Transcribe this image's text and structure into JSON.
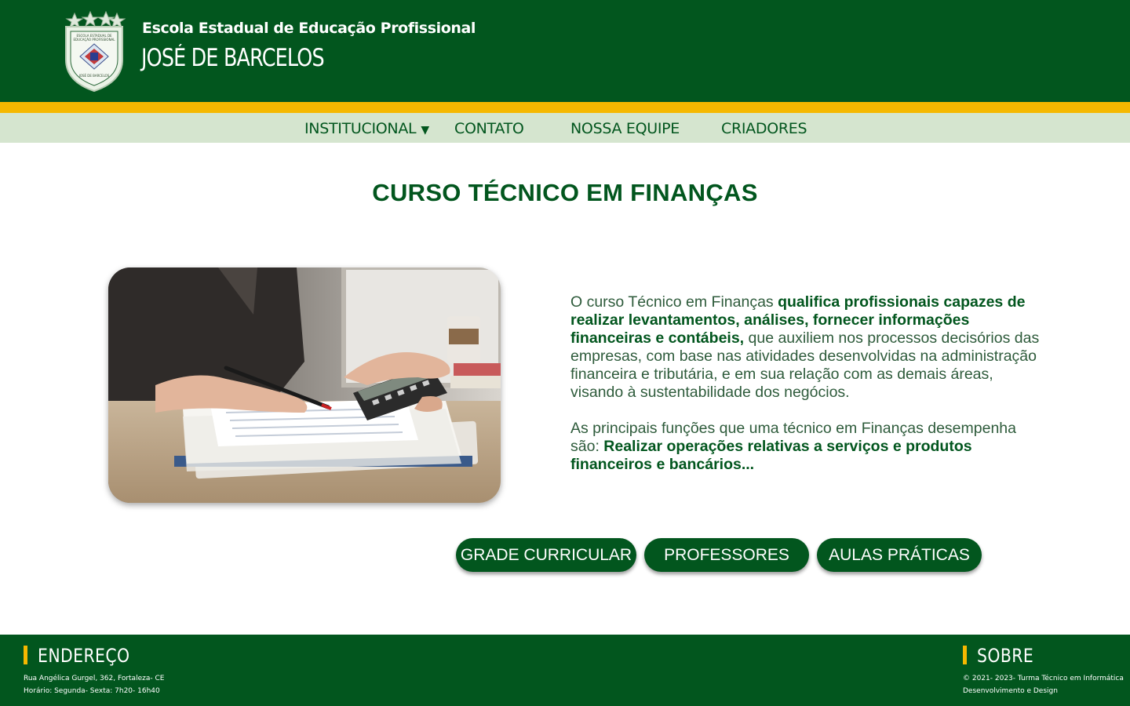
{
  "header": {
    "school_line1": "Escola Estadual de Educação Profissional",
    "school_line2": "JOSÉ DE BARCELOS",
    "logo_icon": "school-crest-icon",
    "logo_text_top": "ESCOLA ESTADUAL DE EDUCAÇÃO PROFISSIONAL",
    "logo_text_bottom": "JOSÉ DE BARCELOS"
  },
  "nav": {
    "items": [
      {
        "label": "INSTITUCIONAL",
        "caret": "▼"
      },
      {
        "label": "CONTATO"
      },
      {
        "label": "NOSSA EQUIPE"
      },
      {
        "label": "CRIADORES"
      }
    ]
  },
  "main": {
    "title": "CURSO TÉCNICO EM FINANÇAS",
    "para1_a": "O curso Técnico em Finanças ",
    "para1_b": "qualifica profissionais capazes de realizar levantamentos, análises, fornecer informações financeiras e contábeis,",
    "para1_c": " que auxiliem nos processos decisórios das empresas, com base nas atividades desenvolvidas na administração financeira e tributária, e em sua relação com as demais áreas, visando à sustentabilidade dos negócios.",
    "para2_a": "As principais funções que uma técnico em Finanças desempenha são: ",
    "para2_b": "Realizar operações relativas a serviços e produtos financeiros e bancários...",
    "buttons": {
      "grade": "GRADE CURRICULAR",
      "professores": "PROFESSORES",
      "aulas": "AULAS PRÁTICAS"
    }
  },
  "footer": {
    "address_heading": "ENDEREÇO",
    "address_line1": "Rua Angélica Gurgel, 362, Fortaleza- CE",
    "address_line2": "Horário: Segunda- Sexta: 7h20- 16h40",
    "about_heading": "SOBRE",
    "about_line1": "© 2021- 2023- Turma Técnico em Informática",
    "about_line2": "Desenvolvimento e Design"
  },
  "colors": {
    "primary_green": "#02561e",
    "accent_yellow": "#f5b800",
    "nav_bg": "#d5e5cf"
  }
}
